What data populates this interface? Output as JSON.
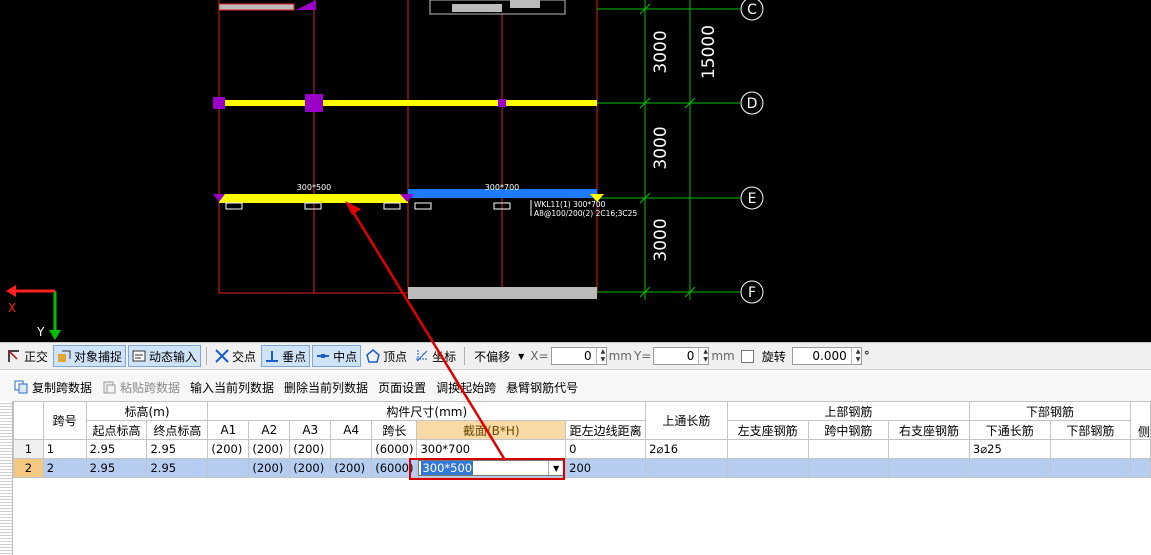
{
  "cad": {
    "axes": [
      "C",
      "D",
      "E",
      "F"
    ],
    "dims": [
      "3000",
      "3000",
      "3000",
      "15000"
    ],
    "beam_labels": [
      "300*500",
      "300*700"
    ],
    "note_line1": "WKL11(1) 300*700",
    "note_line2": "A8@100/200(2) 2C16;3C25",
    "ucs_y": "Y",
    "ucs_x": "X"
  },
  "snapbar": {
    "ortho": "正交",
    "snap": "对象捕捉",
    "dynamic": "动态输入",
    "intersect": "交点",
    "perp": "垂点",
    "mid": "中点",
    "vertex": "顶点",
    "coord": "坐标",
    "offset": "不偏移",
    "x_label": "X=",
    "x_value": "0",
    "unit1": "mm",
    "y_label": "Y=",
    "y_value": "0",
    "unit2": "mm",
    "rotate": "旋转",
    "rotate_value": "0.000",
    "deg": "°"
  },
  "toolbar": {
    "copy": "复制跨数据",
    "paste": "粘贴跨数据",
    "input_col": "输入当前列数据",
    "delete_col": "删除当前列数据",
    "page": "页面设置",
    "swap": "调换起始跨",
    "cantilever": "悬臂钢筋代号"
  },
  "grid": {
    "h_span": "跨号",
    "h_elev": "标高(m)",
    "h_size": "构件尺寸(mm)",
    "h_top": "上通长筋",
    "h_upper": "上部钢筋",
    "h_lower": "下部钢筋",
    "h_start": "起点标高",
    "h_end": "终点标高",
    "h_a1": "A1",
    "h_a2": "A2",
    "h_a3": "A3",
    "h_a4": "A4",
    "h_len": "跨长",
    "h_sec": "截面(B*H)",
    "h_dist": "距左边线距离",
    "h_left": "左支座钢筋",
    "h_mid": "跨中钢筋",
    "h_right": "右支座钢筋",
    "h_bot": "下通长筋",
    "h_lowbar": "下部钢筋",
    "h_side": "侧",
    "rows": [
      {
        "rn": "1",
        "span": "1",
        "start": "2.95",
        "end": "2.95",
        "a1": "(200)",
        "a2": "(200)",
        "a3": "(200)",
        "a4": "",
        "len": "(6000)",
        "sec": "300*700",
        "dist": "0",
        "top": "2⌀16",
        "left": "",
        "mid": "",
        "right": "",
        "bot": "3⌀25",
        "low": ""
      },
      {
        "rn": "2",
        "span": "2",
        "start": "2.95",
        "end": "2.95",
        "a1": "",
        "a2": "(200)",
        "a3": "(200)",
        "a4": "(200)",
        "len": "(6000)",
        "sec": "300*500",
        "dist": "200",
        "top": "",
        "left": "",
        "mid": "",
        "right": "",
        "bot": "",
        "low": ""
      }
    ]
  },
  "colors": {
    "beam_selected": "#ffff00",
    "beam_other": "#1e7bff",
    "axis_line": "#00c000",
    "wall_line": "#e02020",
    "column": "#9b00c8",
    "highlight": "#d40000"
  }
}
